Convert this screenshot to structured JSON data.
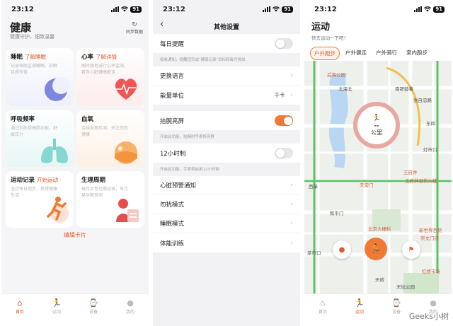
{
  "status": {
    "time": "23:12",
    "battery": "91"
  },
  "health": {
    "title": "健康",
    "subtitle": "健康守护，细致温馨",
    "sync_label": "同步数据",
    "cards": [
      {
        "title": "睡眠",
        "link": "了解睡眠",
        "desc": "记录每晚监测睡眠，舒眠且质有保"
      },
      {
        "title": "心率",
        "link": "了解详情",
        "desc": "随时随地进行心率监测，看有心脏健康解读"
      },
      {
        "title": "呼吸频率",
        "link": "",
        "desc": "通过训练提高肺功能，舒缓压力"
      },
      {
        "title": "血氧",
        "link": "",
        "desc": "连续血氧检测，关注您的健康"
      },
      {
        "title": "运动记录",
        "link": "开始运动",
        "desc": "坚持每日跑步，获得健康生活"
      },
      {
        "title": "生理周期",
        "link": "",
        "desc": "每月女性经期记录，每月易孕期预测"
      }
    ],
    "edit_label": "编辑卡片"
  },
  "tabs": [
    {
      "label": "首页",
      "icon": "home-icon"
    },
    {
      "label": "运动",
      "icon": "run-icon"
    },
    {
      "label": "设备",
      "icon": "watch-icon"
    },
    {
      "label": "我的",
      "icon": "person-icon"
    }
  ],
  "settings": {
    "title": "其他设置",
    "daily_reminder": "每日提醒",
    "daily_note": "接收通知，提醒您完成\"健康记录\"目标和每月挑战",
    "language": "更换语言",
    "energy_unit": "能量单位",
    "energy_value": "千卡",
    "raise_wake": "抬腕亮屏",
    "raise_note": "开启此功能，抬腕时手表将亮屏",
    "h12": "12小时制",
    "h12_note": "开启此功能，手表将启用12小时制",
    "items": [
      "心脏预警通知",
      "勿扰模式",
      "睡眠模式",
      "体能训练"
    ]
  },
  "sport": {
    "title": "运动",
    "subtitle": "快去运动一下吧！",
    "types": [
      "户外跑步",
      "户外健走",
      "户外骑行",
      "室内跑步"
    ],
    "distance_value": "--",
    "distance_unit": "公里",
    "map_labels": [
      "后海公园",
      "北海北",
      "南锣鼓巷",
      "张自忠路",
      "东四",
      "灯市口",
      "西单",
      "天安门",
      "王府井",
      "王府井百货大楼",
      "北京大栅栏",
      "和平门",
      "新世界百货",
      "崇文门店",
      "菜市口",
      "红桥市场",
      "天桥",
      "天坛公园"
    ]
  },
  "watermark": "Geeks小树"
}
